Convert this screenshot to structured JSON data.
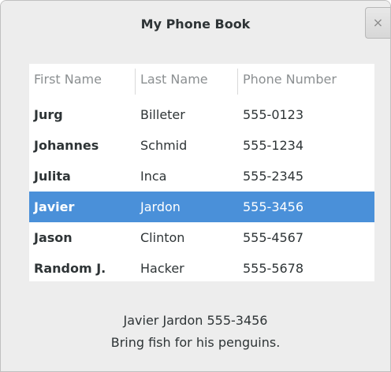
{
  "window": {
    "title": "My Phone Book",
    "close_label": "×"
  },
  "table": {
    "columns": [
      "First Name",
      "Last Name",
      "Phone Number"
    ],
    "rows": [
      {
        "first": "Jurg",
        "last": "Billeter",
        "phone": "555-0123"
      },
      {
        "first": "Johannes",
        "last": "Schmid",
        "phone": "555-1234"
      },
      {
        "first": "Julita",
        "last": "Inca",
        "phone": "555-2345"
      },
      {
        "first": "Javier",
        "last": "Jardon",
        "phone": "555-3456"
      },
      {
        "first": "Jason",
        "last": "Clinton",
        "phone": "555-4567"
      },
      {
        "first": "Random J.",
        "last": "Hacker",
        "phone": "555-5678"
      }
    ],
    "selected_index": 3
  },
  "details": {
    "line1": "Javier Jardon 555-3456",
    "line2": "Bring fish for his penguins."
  },
  "colors": {
    "selection": "#4a90d9",
    "window_bg": "#ededed"
  }
}
